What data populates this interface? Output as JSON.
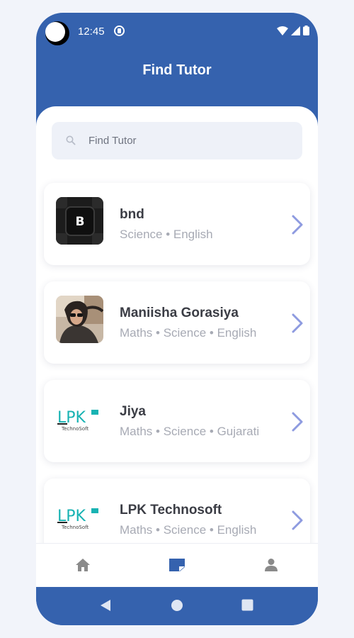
{
  "status_bar": {
    "time": "12:45"
  },
  "header": {
    "title": "Find Tutor"
  },
  "search": {
    "placeholder": "Find Tutor",
    "value": ""
  },
  "tutors": [
    {
      "name": "bnd",
      "subjects": "Science • English",
      "avatar": "keyboard-key-b-photo"
    },
    {
      "name": "Maniisha Gorasiya",
      "subjects": "Maths • Science • English",
      "avatar": "profile-photo"
    },
    {
      "name": "Jiya",
      "subjects": "Maths • Science • Gujarati",
      "avatar": "lpk-technosoft-logo"
    },
    {
      "name": "LPK Technosoft",
      "subjects": "Maths • Science • English",
      "avatar": "lpk-technosoft-logo"
    }
  ],
  "logo_text": {
    "brand": "LPK",
    "sub": "TechnoSoft"
  },
  "bottom_nav": {
    "items": [
      {
        "icon": "home-icon",
        "active": false
      },
      {
        "icon": "note-icon",
        "active": true
      },
      {
        "icon": "person-icon",
        "active": false
      }
    ]
  },
  "system_nav": [
    "back-icon",
    "home-circle-icon",
    "recents-icon"
  ],
  "colors": {
    "primary": "#3562ae",
    "chevron": "#8e9be0",
    "name_text": "#3b3d45",
    "subject_text": "#a7aab4",
    "search_bg": "#eef1f8",
    "nav_inactive": "#8a8a8a",
    "logo_teal": "#18b3b3"
  }
}
